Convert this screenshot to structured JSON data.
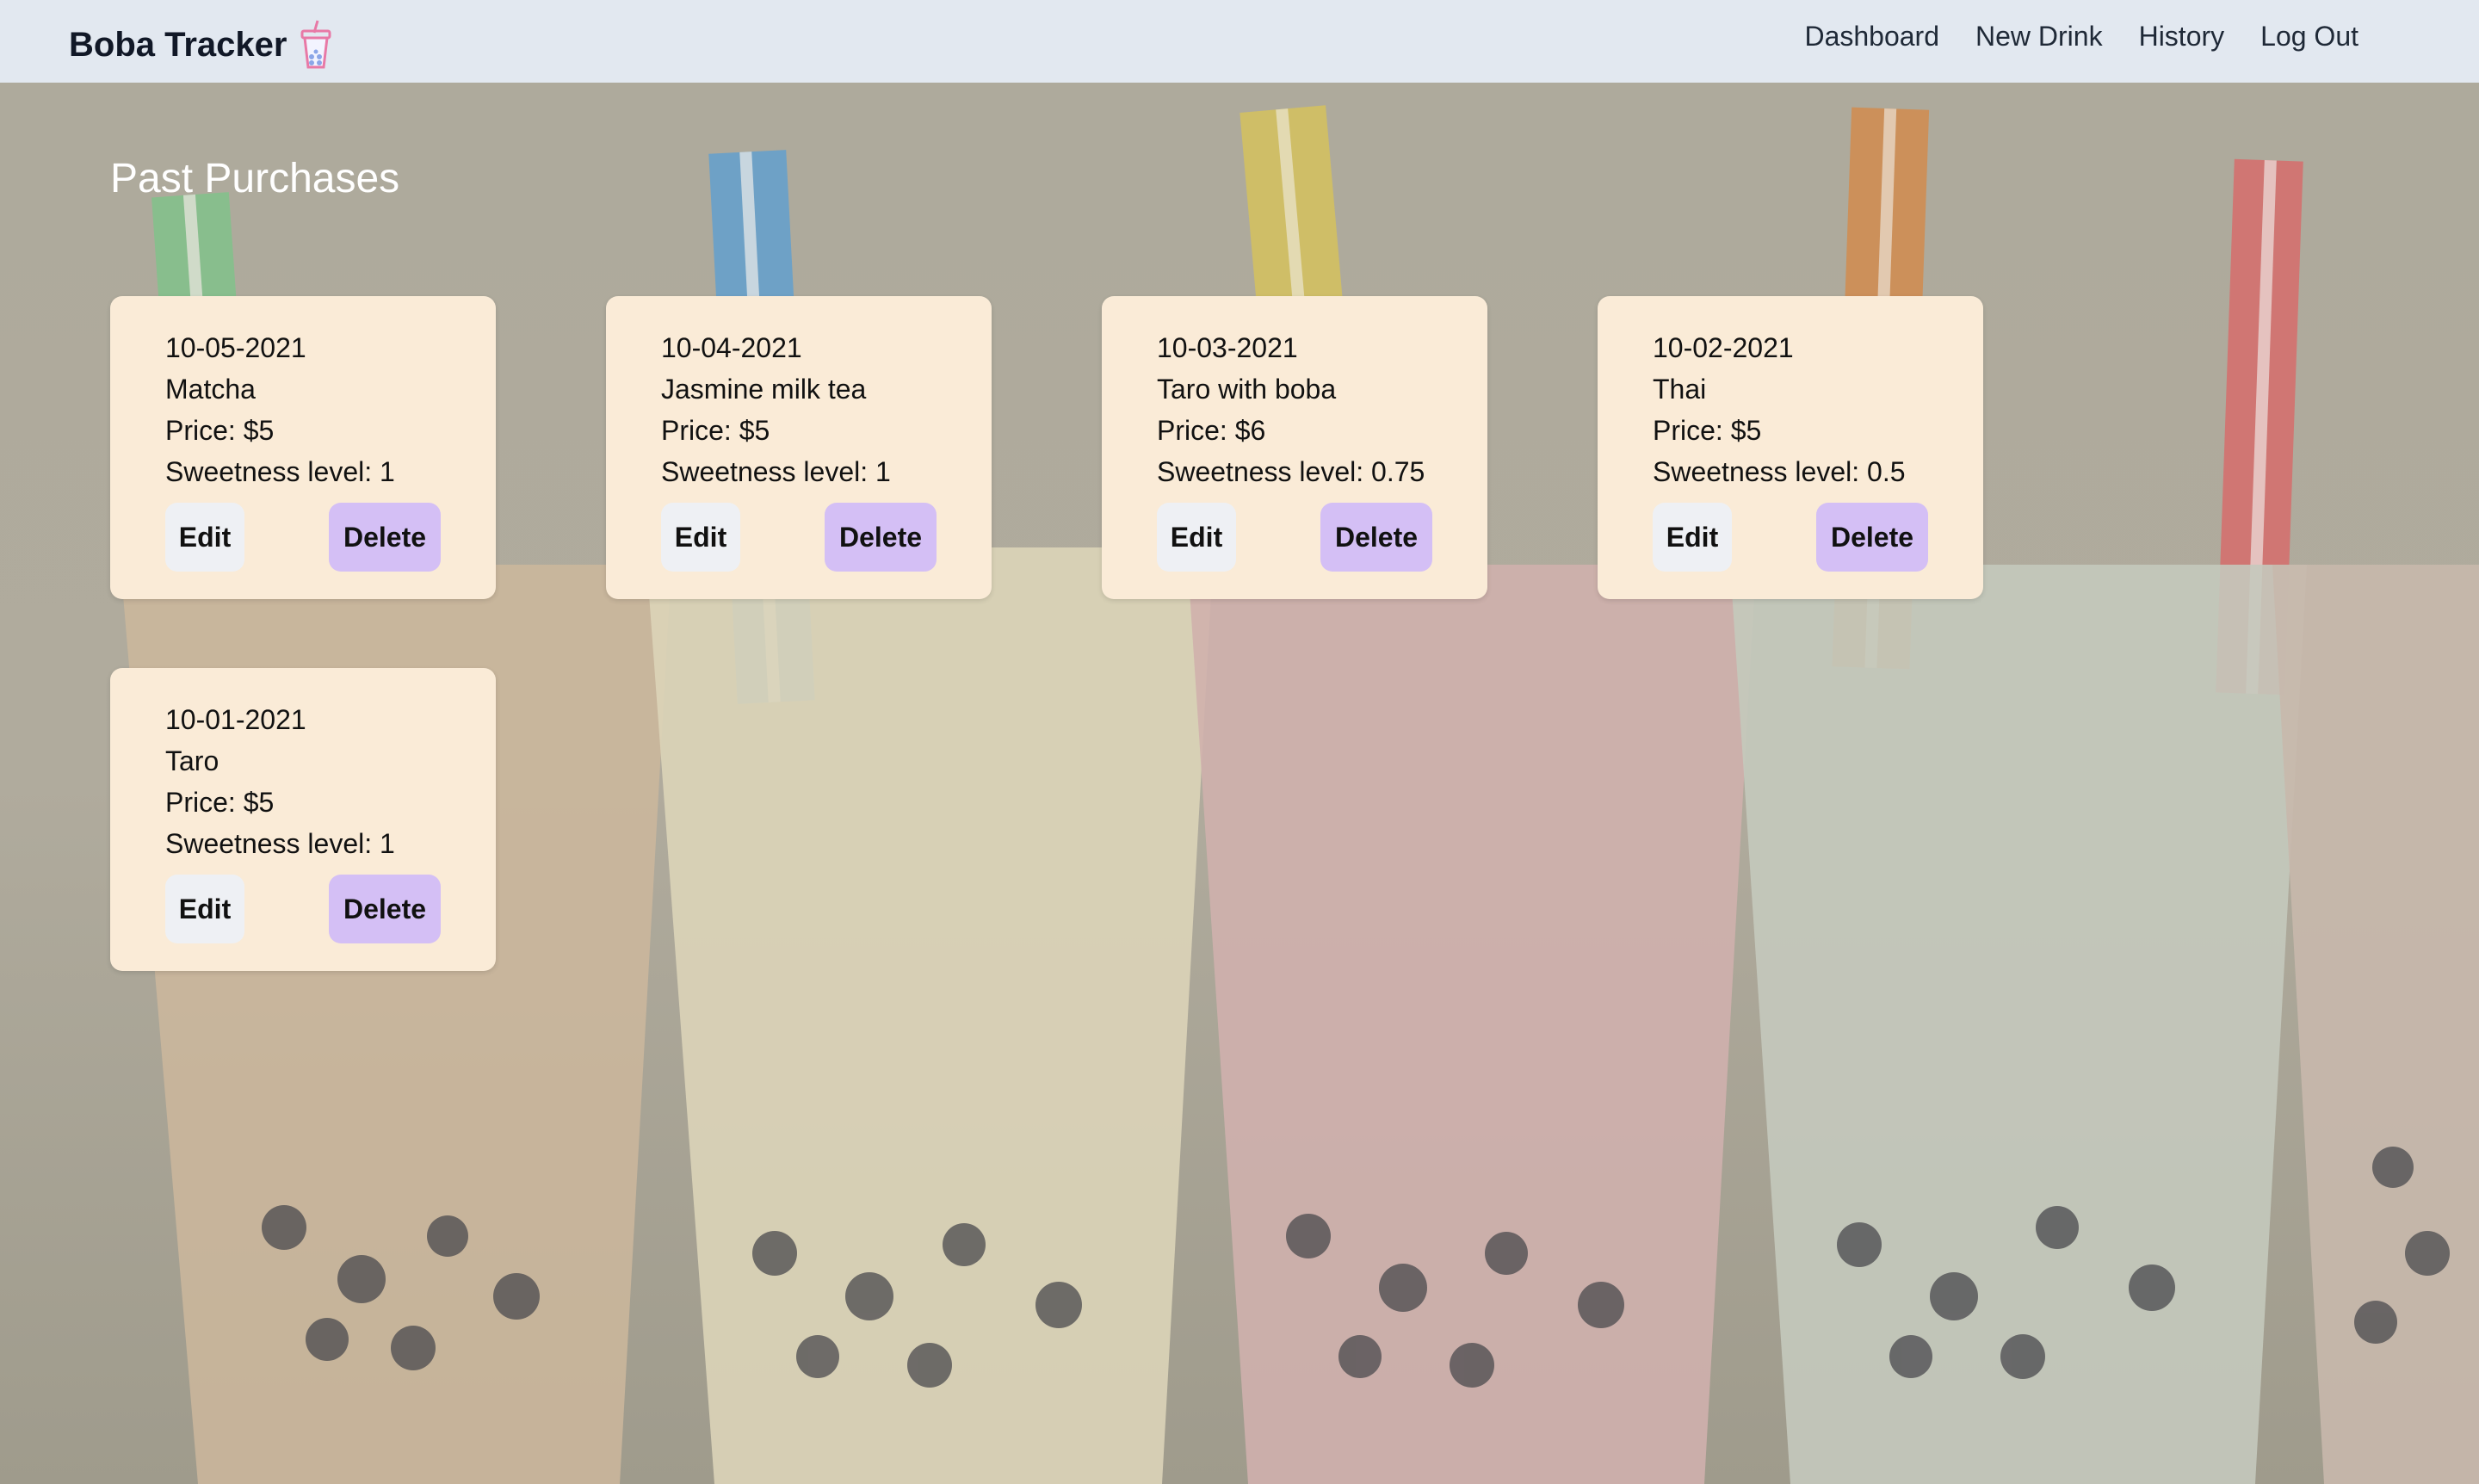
{
  "navbar": {
    "brand": "Boba Tracker",
    "brand_icon": "boba-cup-icon",
    "links": [
      "Dashboard",
      "New Drink",
      "History",
      "Log Out"
    ]
  },
  "main": {
    "title": "Past Purchases",
    "purchases": [
      {
        "date": "10-05-2021",
        "drink": "Matcha",
        "price": "Price: $5",
        "sweetness": "Sweetness level: 1",
        "edit_label": "Edit",
        "delete_label": "Delete"
      },
      {
        "date": "10-04-2021",
        "drink": "Jasmine milk tea",
        "price": "Price: $5",
        "sweetness": "Sweetness level: 1",
        "edit_label": "Edit",
        "delete_label": "Delete"
      },
      {
        "date": "10-03-2021",
        "drink": "Taro with boba",
        "price": "Price: $6",
        "sweetness": "Sweetness level: 0.75",
        "edit_label": "Edit",
        "delete_label": "Delete"
      },
      {
        "date": "10-02-2021",
        "drink": "Thai",
        "price": "Price: $5",
        "sweetness": "Sweetness level: 0.5",
        "edit_label": "Edit",
        "delete_label": "Delete"
      },
      {
        "date": "10-01-2021",
        "drink": "Taro",
        "price": "Price: $5",
        "sweetness": "Sweetness level: 1",
        "edit_label": "Edit",
        "delete_label": "Delete"
      }
    ]
  },
  "colors": {
    "navbar_bg": "#e2e8f0",
    "card_bg": "#faebd7",
    "edit_button_bg": "#eef0f4",
    "delete_button_bg": "#d4bff5",
    "title_color": "#ffffff"
  }
}
